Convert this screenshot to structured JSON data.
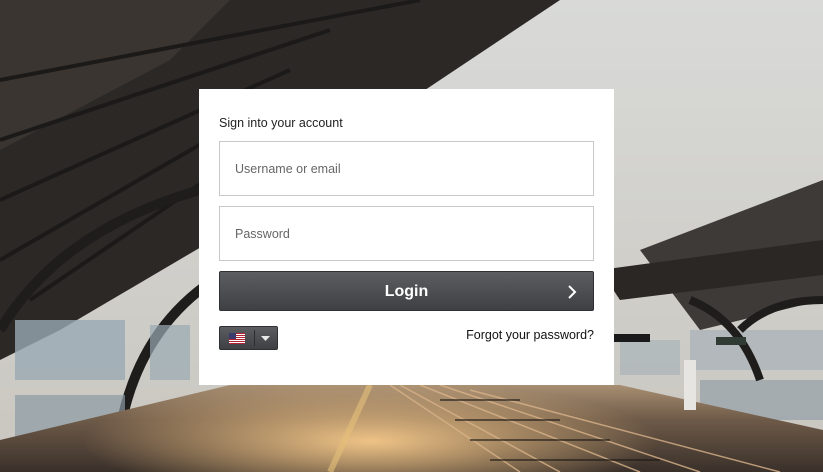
{
  "login": {
    "title": "Sign into your account",
    "username_placeholder": "Username or email",
    "password_placeholder": "Password",
    "login_label": "Login",
    "forgot_label": "Forgot your password?",
    "language": {
      "flag_icon": "us-flag-icon",
      "dropdown_icon": "caret-down-icon"
    }
  },
  "colors": {
    "button_dark": "#45474a",
    "card_bg": "#ffffff"
  }
}
